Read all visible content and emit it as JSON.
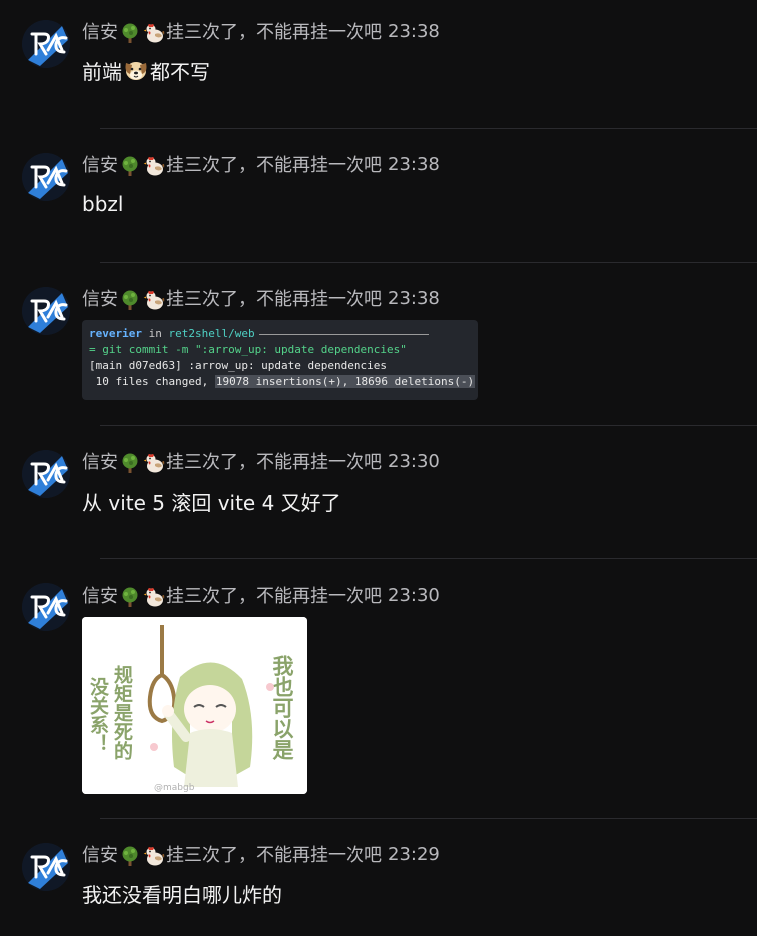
{
  "sender": {
    "name_prefix": "信安",
    "tree_icon": "tree-emoji",
    "hen_icon": "chicken-emoji",
    "name_suffix": "挂三次了，不能再挂一次吧"
  },
  "messages": [
    {
      "time": "23:38",
      "text_before": "前端",
      "emoji": "dog-face-emoji",
      "text_after": "都不写"
    },
    {
      "time": "23:38",
      "text": "bbzl"
    },
    {
      "time": "23:38",
      "terminal": {
        "user": "reverier",
        "in": "in",
        "path": "ret2shell/web",
        "prompt": "=",
        "cmd": "git commit -m \":arrow_up: update dependencies\"",
        "line2": "[main d07ed63] :arrow_up: update dependencies",
        "line3_pre": " 10 files changed, ",
        "line3_hl": "19078 insertions(+), 18696 deletions(-)"
      }
    },
    {
      "time": "23:30",
      "text": "从 vite 5 滚回 vite 4 又好了"
    },
    {
      "time": "23:30",
      "sticker": {
        "left_col1": "规矩是死的",
        "left_col2": "没关系！",
        "right_col": "我也可以是",
        "watermark": "@mabgb"
      }
    },
    {
      "time": "23:29",
      "text": "我还没看明白哪儿炸的"
    }
  ],
  "colors": {
    "background": "#0f0f10",
    "header_text": "#b9b9bd",
    "body_text": "#f2f2f2",
    "divider": "#2a2a2e",
    "avatar_blue": "#2f7fd9"
  }
}
